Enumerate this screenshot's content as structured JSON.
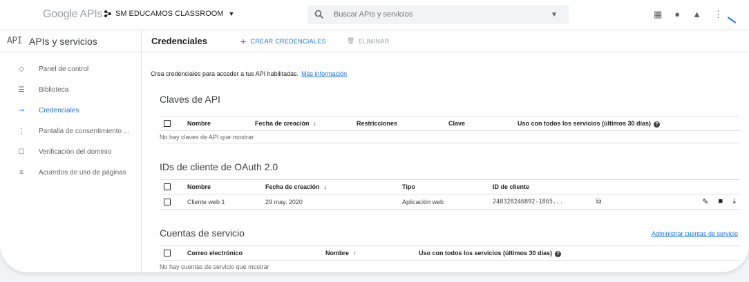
{
  "header": {
    "logo_google": "Google",
    "logo_apis": "APIs",
    "project_name": "SM EDUCAMOS CLASSROOM",
    "search_placeholder": "Buscar APIs y servicios"
  },
  "sidebar": {
    "badge": "API",
    "title": "APIs y servicios",
    "items": [
      {
        "label": "Panel de control",
        "icon": "dashboard-icon",
        "active": false
      },
      {
        "label": "Biblioteca",
        "icon": "library-icon",
        "active": false
      },
      {
        "label": "Credenciales",
        "icon": "key-icon",
        "active": true
      },
      {
        "label": "Pantalla de consentimiento ...",
        "icon": "consent-screen-icon",
        "active": false
      },
      {
        "label": "Verificación del dominio",
        "icon": "domain-verification-icon",
        "active": false
      },
      {
        "label": "Acuerdos de uso de páginas",
        "icon": "page-agreements-icon",
        "active": false
      }
    ]
  },
  "toolbar": {
    "page_title": "Credenciales",
    "create_label": "CREAR CREDENCIALES",
    "delete_label": "ELIMINAR"
  },
  "intro": {
    "text": "Crea credenciales para acceder a tus API habilitadas.",
    "link": "Más información"
  },
  "api_keys": {
    "title": "Claves de API",
    "columns": [
      "Nombre",
      "Fecha de creación",
      "Restricciones",
      "Clave",
      "Uso con todos los servicios (últimos 30 días)"
    ],
    "empty": "No hay claves de API que mostrar"
  },
  "oauth": {
    "title": "IDs de cliente de OAuth 2.0",
    "columns": [
      "Nombre",
      "Fecha de creación",
      "Tipo",
      "ID de cliente"
    ],
    "rows": [
      {
        "name": "Cliente web 1",
        "date": "29 may. 2020",
        "type": "Aplicación web",
        "client_id": "248328246892-1865..."
      }
    ]
  },
  "service_accounts": {
    "title": "Cuentas de servicio",
    "manage_link": "Administrar cuentas de servicio",
    "columns": [
      "Correo electrónico",
      "Nombre",
      "Uso con todos los servicios (últimos 30 días)"
    ],
    "empty": "No hay cuentas de servicio que mostrar"
  },
  "colors": {
    "accent": "#1a73e8",
    "text": "#202124",
    "muted": "#5f6368",
    "divider": "#e0e0e0"
  }
}
